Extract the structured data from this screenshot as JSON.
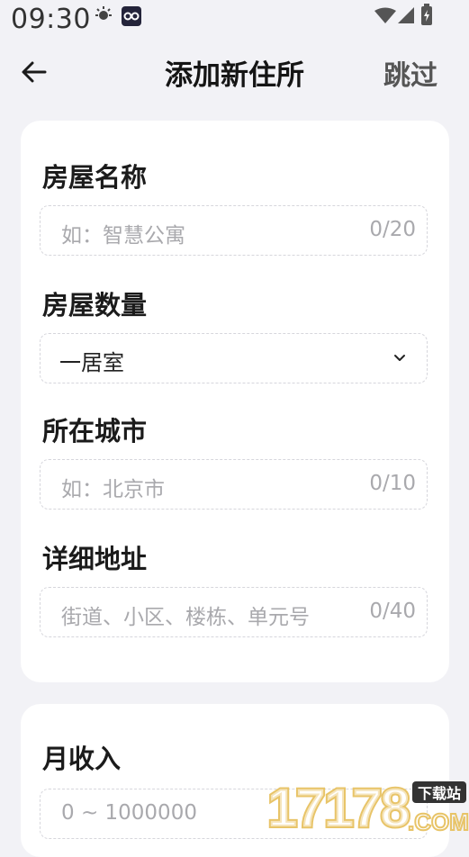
{
  "status_bar": {
    "time": "09:30",
    "icons": [
      "lightbulb-icon",
      "app-notification-icon",
      "wifi-icon",
      "signal-icon",
      "battery-icon"
    ]
  },
  "nav": {
    "back_icon": "arrow-left-icon",
    "title": "添加新住所",
    "skip_label": "跳过"
  },
  "form": {
    "house_name": {
      "label": "房屋名称",
      "placeholder": "如：智慧公寓",
      "counter": "0/20"
    },
    "house_count": {
      "label": "房屋数量",
      "value": "一居室",
      "icon": "chevron-down-icon"
    },
    "city": {
      "label": "所在城市",
      "placeholder": "如：北京市",
      "counter": "0/10"
    },
    "address": {
      "label": "详细地址",
      "placeholder": "街道、小区、楼栋、单元号",
      "counter": "0/40"
    }
  },
  "income": {
    "label": "月收入",
    "placeholder": "0 ~ 1000000"
  },
  "watermark": {
    "number": "17178",
    "badge": "下载站",
    "domain": ".COM"
  },
  "colors": {
    "background": "#f2f2f6",
    "card": "#ffffff",
    "text_primary": "#1b1b1b",
    "placeholder": "#a9a9ad",
    "watermark_gold": "#e8c468"
  }
}
